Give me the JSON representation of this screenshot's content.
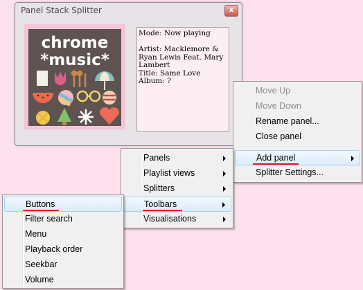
{
  "window": {
    "title": "Panel Stack Splitter",
    "close_glyph": "x",
    "album_art_text": [
      "chrome",
      "*music*"
    ],
    "info_text": "Mode: Now playing\n\nArtist: Macklemore & Ryan Lewis Feat. Mary Lambert\nTitle: Same Love\nAlbum: ?"
  },
  "menu_right": {
    "items": [
      {
        "label": "Move Up",
        "disabled": true
      },
      {
        "label": "Move Down",
        "disabled": true
      },
      {
        "label": "Rename panel..."
      },
      {
        "label": "Close panel"
      },
      {
        "label": "Add panel",
        "submenu": true,
        "highlighted": true
      },
      {
        "label": "Splitter Settings..."
      }
    ]
  },
  "menu_middle": {
    "items": [
      {
        "label": "Panels",
        "submenu": true
      },
      {
        "label": "Playlist views",
        "submenu": true
      },
      {
        "label": "Splitters",
        "submenu": true
      },
      {
        "label": "Toolbars",
        "submenu": true,
        "highlighted": true
      },
      {
        "label": "Visualisations",
        "submenu": true
      }
    ]
  },
  "menu_left": {
    "items": [
      {
        "label": "Buttons",
        "highlighted": true
      },
      {
        "label": "Filter search"
      },
      {
        "label": "Menu"
      },
      {
        "label": "Playback order"
      },
      {
        "label": "Seekbar"
      },
      {
        "label": "Volume"
      }
    ]
  },
  "colors": {
    "desktop": "#fce0ec",
    "underline": "#e8102e",
    "highlight_border": "#a8d0f5"
  }
}
